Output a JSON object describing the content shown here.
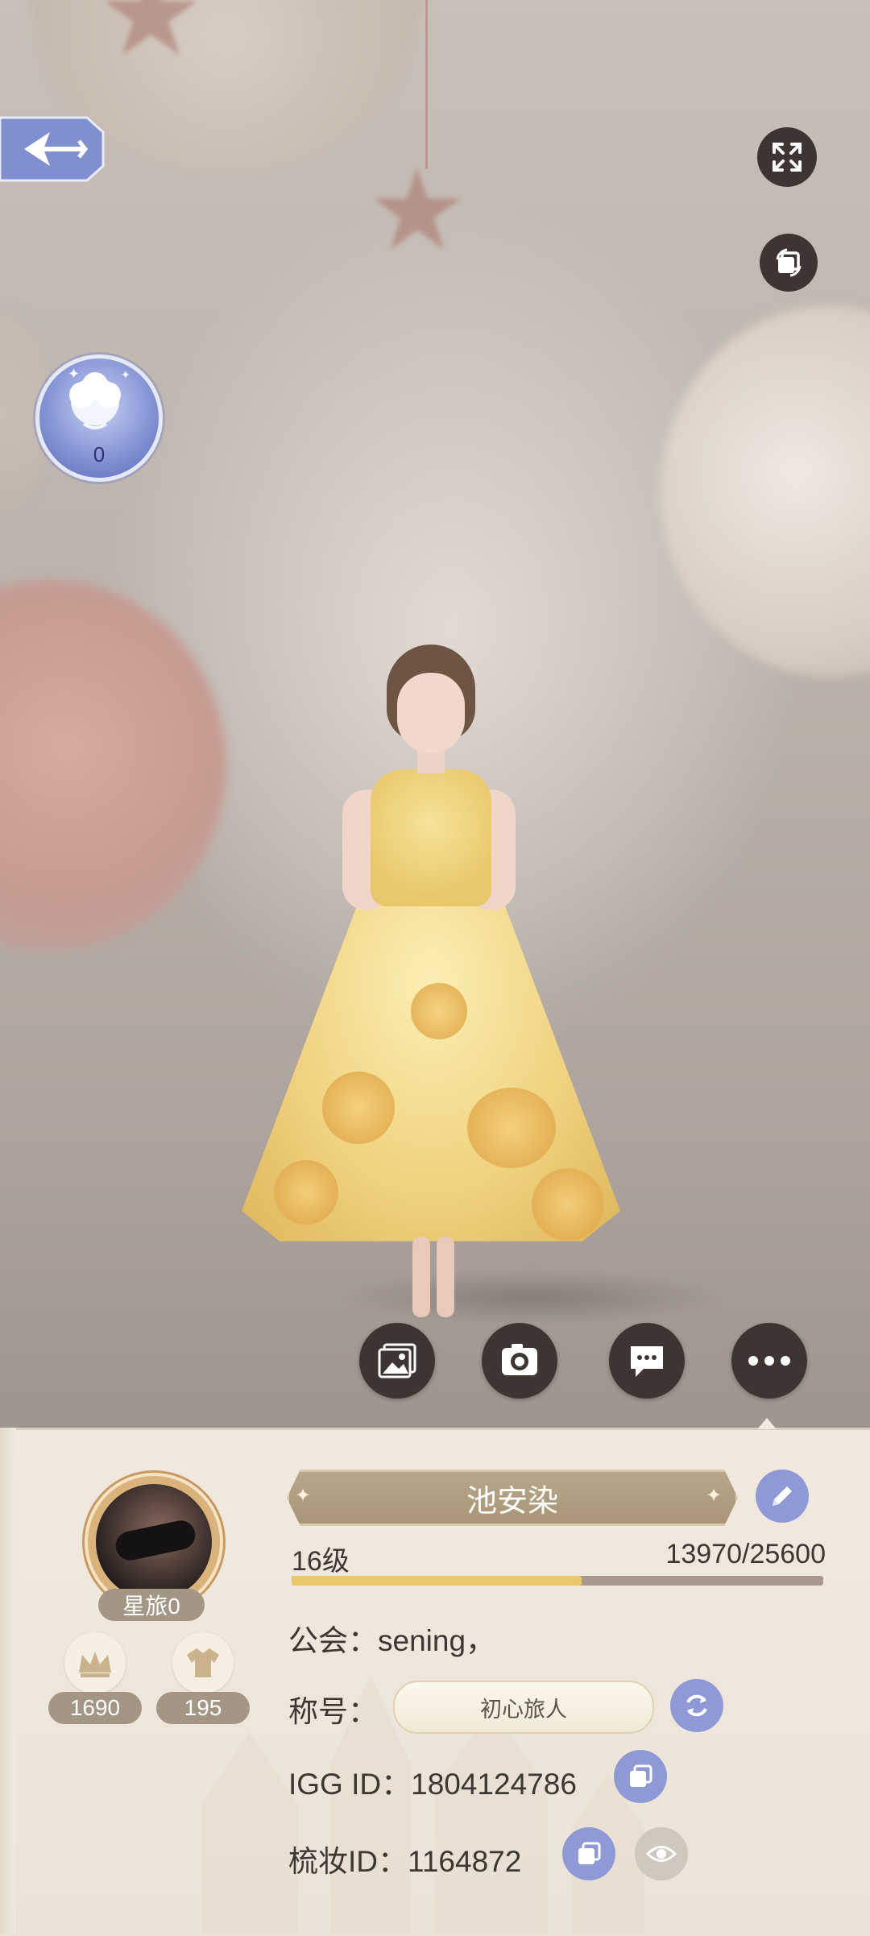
{
  "scene": {
    "rose_count": "0"
  },
  "actions": [
    {
      "name": "gallery",
      "icon": "image-icon"
    },
    {
      "name": "camera",
      "icon": "camera-icon"
    },
    {
      "name": "chat",
      "icon": "chat-icon"
    },
    {
      "name": "more",
      "icon": "more-icon"
    }
  ],
  "profile": {
    "name": "池安染",
    "level": "16级",
    "exp_text": "13970/25600",
    "exp_fraction": 0.5457,
    "avatar_tag": "星旅0",
    "stat_crown": "1690",
    "stat_outfit": "195",
    "guild": "公会：sening，",
    "title_label": "称号：",
    "title_value": "初心旅人",
    "igg_id": "IGG ID：1804124786",
    "makeup_id": "梳妆ID：1164872"
  },
  "colors": {
    "accent_button": "#8f99d6",
    "name_bar": "#a99678",
    "exp_fill": "#ebc767",
    "dark_button": "#3e3533"
  }
}
